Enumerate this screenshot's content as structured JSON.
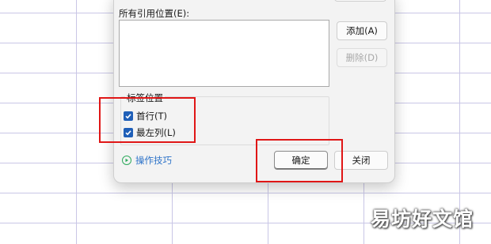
{
  "dialog": {
    "ref_label": "所有引用位置(E):",
    "add_button": "添加(A)",
    "delete_button": "删除(D)",
    "label_group_title": "标签位置",
    "checkboxes": [
      {
        "label": "首行(T)",
        "checked": true
      },
      {
        "label": "最左列(L)",
        "checked": true
      }
    ],
    "tips_link": "操作技巧",
    "ok_button": "确定",
    "close_button": "关闭"
  },
  "colors": {
    "highlight": "#e01616",
    "checkbox": "#1f5fb8",
    "link": "#2f74c9",
    "grid": "#c9c6e6"
  },
  "watermark": "易坊好文馆"
}
